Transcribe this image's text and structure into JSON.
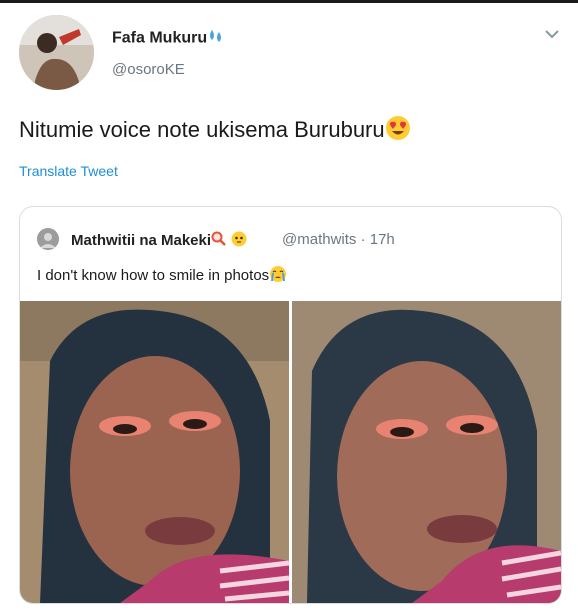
{
  "author": {
    "name": "Fafa Mukuru",
    "name_emoji_icon": "sweat-droplets-icon",
    "handle": "@osoroKE",
    "avatar_icon": "user-avatar-photo"
  },
  "tweet": {
    "text": "Nitumie voice note ukisema Buruburu",
    "emoji_icon": "heart-eyes-emoji-icon"
  },
  "translate_label": "Translate Tweet",
  "quoted": {
    "name": "Mathwitii na Makeki",
    "name_emoji_icons": [
      "magnifier-icon",
      "flushed-face-icon"
    ],
    "handle_time": "@mathwits · 17h",
    "text": "I don't know how to smile in photos",
    "text_emoji_icon": "crying-face-icon",
    "photos": [
      {
        "alt_icon": "selfie-photo"
      },
      {
        "alt_icon": "selfie-photo"
      }
    ]
  },
  "colors": {
    "link": "#1d8fd6",
    "muted": "#6b7780",
    "border": "#d8dde1"
  }
}
